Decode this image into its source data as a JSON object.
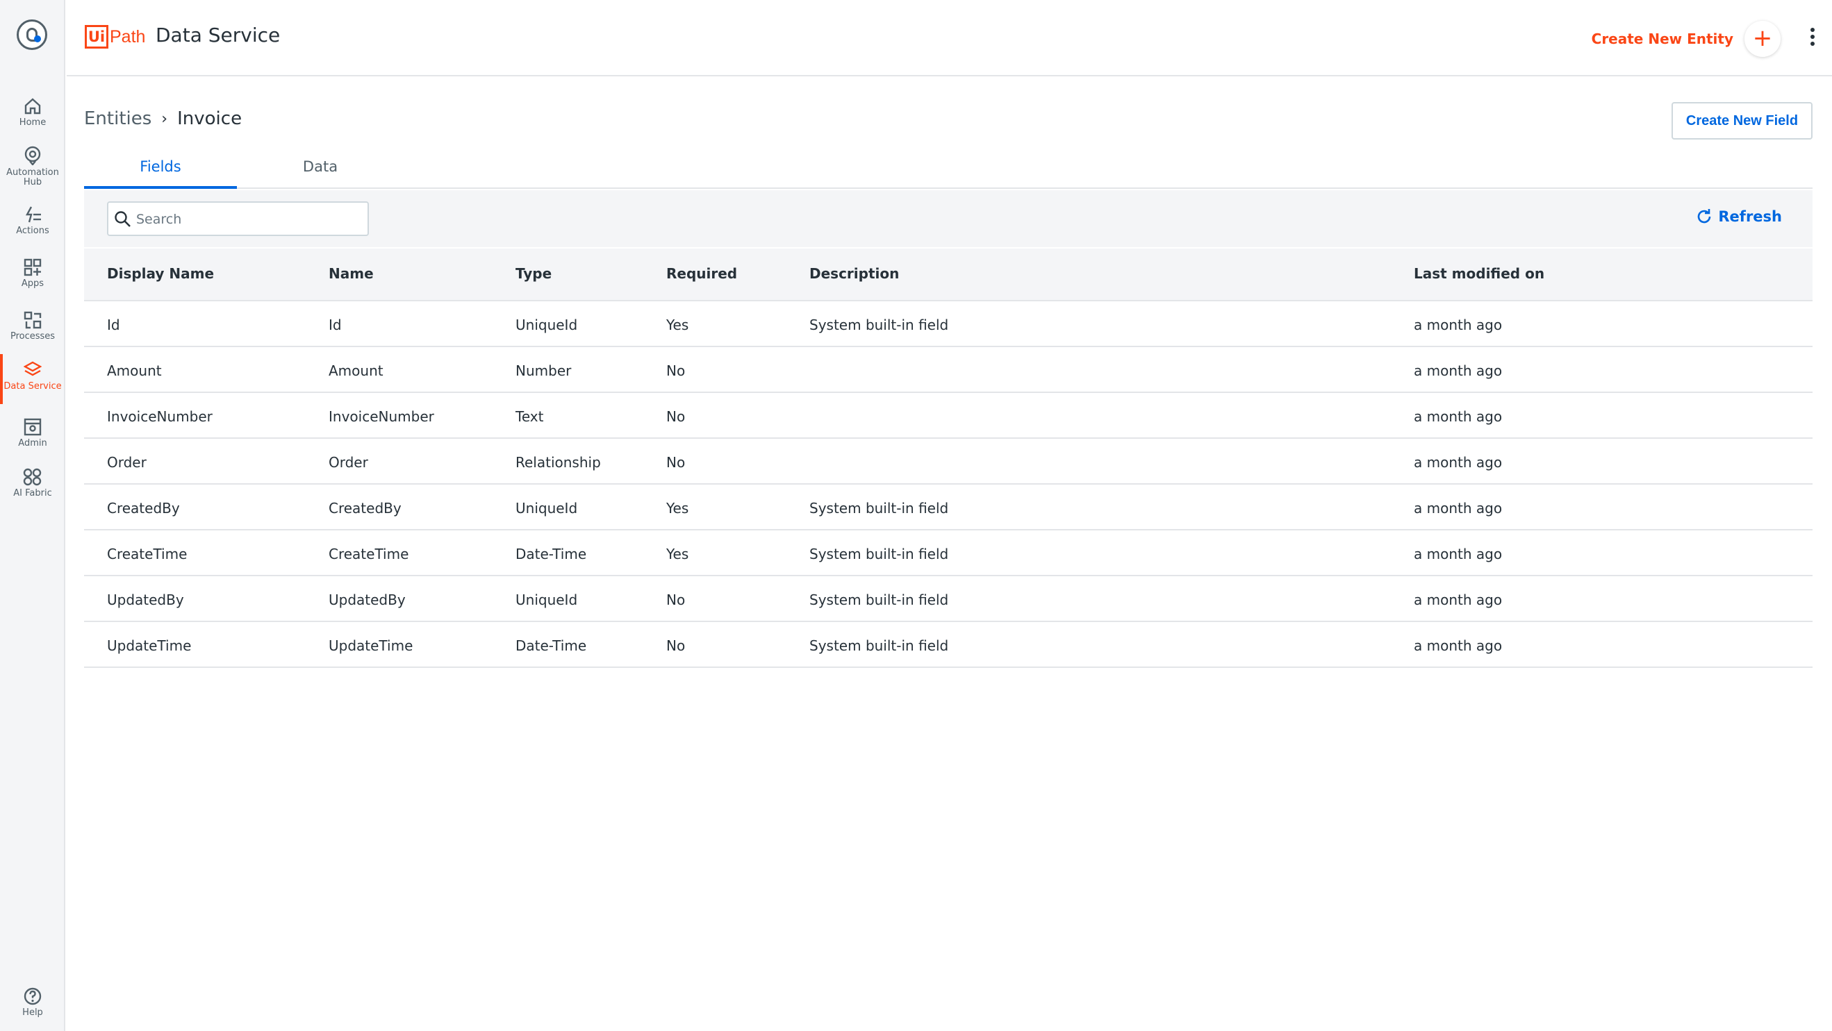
{
  "header": {
    "brand_ui": "Ui",
    "brand_path": "Path",
    "app_title": "Data Service",
    "create_entity_label": "Create New Entity"
  },
  "rail": {
    "items": [
      {
        "label": "Home",
        "icon": "home-icon"
      },
      {
        "label": "Automation Hub",
        "icon": "automation-hub-icon"
      },
      {
        "label": "Actions",
        "icon": "actions-icon"
      },
      {
        "label": "Apps",
        "icon": "apps-icon"
      },
      {
        "label": "Processes",
        "icon": "processes-icon"
      },
      {
        "label": "Data Service",
        "icon": "data-service-icon",
        "active": true
      },
      {
        "label": "Admin",
        "icon": "admin-icon"
      },
      {
        "label": "AI Fabric",
        "icon": "ai-fabric-icon"
      }
    ],
    "help_label": "Help"
  },
  "breadcrumb": {
    "root": "Entities",
    "separator": "›",
    "current": "Invoice"
  },
  "create_field_label": "Create New Field",
  "tabs": [
    {
      "label": "Fields",
      "active": true
    },
    {
      "label": "Data",
      "active": false
    }
  ],
  "search": {
    "placeholder": "Search",
    "value": ""
  },
  "refresh_label": "Refresh",
  "table": {
    "columns": [
      "Display Name",
      "Name",
      "Type",
      "Required",
      "Description",
      "Last modified on"
    ],
    "rows": [
      [
        "Id",
        "Id",
        "UniqueId",
        "Yes",
        "System built-in field",
        "a month ago"
      ],
      [
        "Amount",
        "Amount",
        "Number",
        "No",
        "",
        "a month ago"
      ],
      [
        "InvoiceNumber",
        "InvoiceNumber",
        "Text",
        "No",
        "",
        "a month ago"
      ],
      [
        "Order",
        "Order",
        "Relationship",
        "No",
        "",
        "a month ago"
      ],
      [
        "CreatedBy",
        "CreatedBy",
        "UniqueId",
        "Yes",
        "System built-in field",
        "a month ago"
      ],
      [
        "CreateTime",
        "CreateTime",
        "Date-Time",
        "Yes",
        "System built-in field",
        "a month ago"
      ],
      [
        "UpdatedBy",
        "UpdatedBy",
        "UniqueId",
        "No",
        "System built-in field",
        "a month ago"
      ],
      [
        "UpdateTime",
        "UpdateTime",
        "Date-Time",
        "No",
        "System built-in field",
        "a month ago"
      ]
    ]
  },
  "colors": {
    "brand": "#fa4616",
    "accent": "#0067df",
    "border": "#e3e5e8",
    "rail_bg": "#f4f5f7"
  }
}
